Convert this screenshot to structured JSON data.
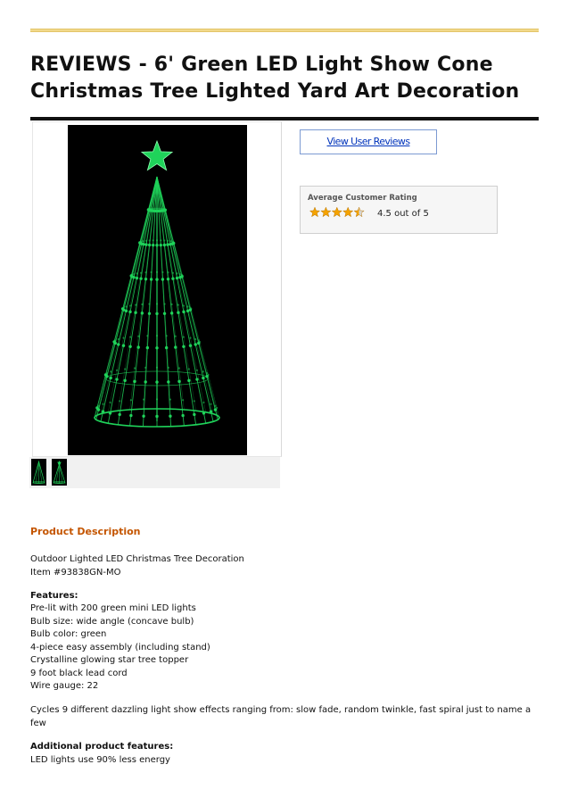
{
  "header": {
    "title_line1": "REVIEWS - 6' Green LED Light Show Cone",
    "title_line2": "Christmas Tree Lighted Yard Art Decoration"
  },
  "product_image": {
    "alt": "green-led-cone-tree"
  },
  "thumbnails": [
    "thumb-1",
    "thumb-2"
  ],
  "reviews_button": {
    "label": "View User Reviews"
  },
  "rating": {
    "heading": "Average Customer Rating",
    "value": 4.5,
    "max": 5,
    "text": "4.5 out of 5",
    "star_color": "#f5a300"
  },
  "description": {
    "heading": "Product Description",
    "line1": "Outdoor Lighted LED Christmas Tree Decoration",
    "line2": "Item #93838GN-MO",
    "features_heading": "Features:",
    "features": [
      "Pre-lit with 200 green mini LED lights",
      "Bulb size: wide angle (concave bulb)",
      "Bulb color: green",
      "4-piece easy assembly (including stand)",
      "Crystalline glowing star tree topper",
      "9 foot black lead cord",
      "Wire gauge: 22"
    ],
    "cycles_text": "Cycles 9 different dazzling light show effects ranging from: slow fade, random twinkle, fast spiral just to name a few",
    "additional_heading": "Additional product features:",
    "additional": [
      "LED lights use 90% less energy"
    ]
  },
  "colors": {
    "accent": "#c45500",
    "link": "#0033bb",
    "led_green": "#1fd35a"
  }
}
